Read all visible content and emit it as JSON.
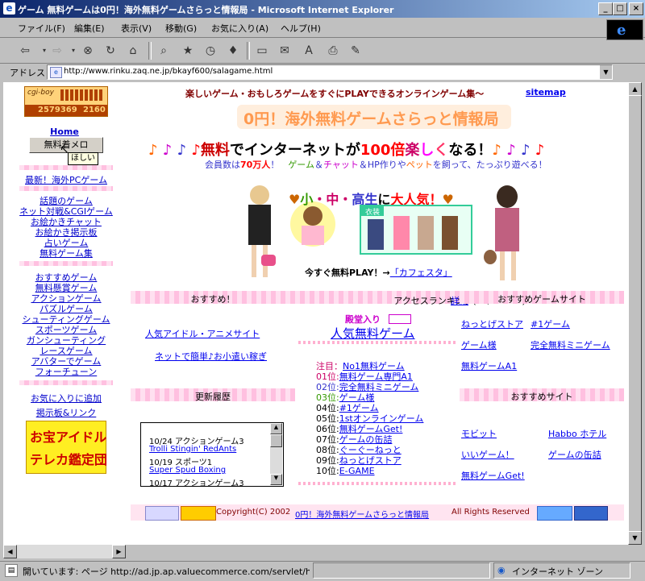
{
  "window": {
    "title": "ゲーム 無料ゲームは0円！海外無料ゲームさらっと情報局 - Microsoft Internet Explorer"
  },
  "menu": [
    "ファイル(F)",
    "編集(E)",
    "表示(V)",
    "移動(G)",
    "お気に入り(A)",
    "ヘルプ(H)"
  ],
  "address": {
    "label": "アドレス",
    "url": "http://www.rinku.zaq.ne.jp/bkayf600/salagame.html"
  },
  "counter": {
    "brand": "cgi-boy",
    "total": "2579369",
    "today": "2160"
  },
  "left_nav": {
    "home": "Home",
    "button": "無料着メロ",
    "tooltip": "ほしい",
    "group1": [
      "最新！海外PCゲーム"
    ],
    "group2": [
      "話題のゲーム",
      "ネット対戦&CGIゲーム",
      "お絵かきチャット",
      "お絵かき掲示板",
      "占いゲーム",
      "無料ゲーム集"
    ],
    "group3": [
      "おすすめゲーム",
      "無料懸賞ゲーム",
      "アクションゲーム",
      "パズルゲーム",
      "シューティングゲーム",
      "スポーツゲーム",
      "ガンシューティング",
      "レースゲーム",
      "アバターでゲーム",
      "フォーチューン"
    ],
    "group4": [
      "お気に入りに追加",
      "掲示板&リンク"
    ],
    "banner_line1": "お宝アイドル",
    "banner_line2": "テレカ鑑定団"
  },
  "top_tagline": "楽しいゲーム・おもしろゲームをすぐにPLAYできるオンラインゲーム集～",
  "sitemap": "sitemap",
  "site_title": "0円！海外無料ゲームさらっと情報局",
  "promo": {
    "notes": "♪ ♪ ♪ ♪",
    "notes_right": "♪ ♪ ♪ ♪",
    "w1": "無料",
    "w2": "でインターネットが",
    "w3": "100倍",
    "w4": "楽",
    "w5": "し",
    "w6": "く",
    "w7": "なる！",
    "sub1": "会員数は",
    "sub2": "70万人",
    "sub3": "！　",
    "sub4": "ゲーム",
    "sub5": "＆",
    "sub6": "チャット",
    "sub7": "＆HP作りや",
    "sub8": "ペット",
    "sub9": "を飼って、たっぷり遊べる！"
  },
  "school": {
    "heart": "♥",
    "sho": "小",
    "dot": "・",
    "chu": "中",
    "kou": "高生",
    "ni": "に",
    "big": "大人気！",
    "costume": "衣装"
  },
  "cafe": {
    "pre": "今すぐ無料PLAY！→",
    "link": "「カフェスタ」"
  },
  "bars": {
    "osusume": "おすすめ！",
    "ranking": "アクセスランキング(10/19～26)",
    "detail": "詳細",
    "recommended_sites": "おすすめゲームサイト",
    "history": "更新履歴",
    "recommended": "おすすめサイト"
  },
  "left_links": [
    "人気アイドル・アニメサイト",
    "ネットで簡単♪お小遣い稼ぎ"
  ],
  "hall": {
    "label": "殿堂入り",
    "link": "人気無料ゲーム"
  },
  "ranking": {
    "top_label": "注目：",
    "top_item": "No1無料ゲーム",
    "items": [
      {
        "pos": "01位:",
        "name": "無料ゲーム専門A1"
      },
      {
        "pos": "02位:",
        "name": "完全無料ミニゲーム"
      },
      {
        "pos": "03位:",
        "name": "ゲーム様"
      },
      {
        "pos": "04位:",
        "name": "#1ゲーム"
      },
      {
        "pos": "05位:",
        "name": "1stオンラインゲーム"
      },
      {
        "pos": "06位:",
        "name": "無料ゲームGet!"
      },
      {
        "pos": "07位:",
        "name": "ゲームの缶詰"
      },
      {
        "pos": "08位:",
        "name": "ぐーぐーねっと"
      },
      {
        "pos": "09位:",
        "name": "ねっとげストア"
      },
      {
        "pos": "10位:",
        "name": "E-GAME"
      }
    ]
  },
  "right_sites1": [
    "ねっとげストア",
    "#1ゲーム",
    "ゲーム様",
    "完全無料ミニゲーム",
    "無料ゲームA1"
  ],
  "right_sites2": [
    "モビット",
    "Habbo ホテル",
    "いいゲーム！",
    "ゲームの缶詰",
    "無料ゲームGet!"
  ],
  "history": [
    "10/24 アクションゲーム3",
    "Trolli Stingin' RedAnts",
    "10/19 スポーツ1",
    "Super Spud Boxing",
    "10/17 アクションゲーム3"
  ],
  "footer": {
    "copyright": "Copyright(C) 2002",
    "site": "0円！海外無料ゲームさらっと情報局",
    "rights": "All Rights Reserved"
  },
  "status": {
    "text": "開いています: ページ http://ad.jp.ap.valuecommerce.com/servlet/htmlbanner?sid=...",
    "zone": "インターネット ゾーン"
  },
  "colors": {
    "title_bar": "#0a246a",
    "link": "#0000cc",
    "pink": "#ffc0e0",
    "orange": "#ff6600"
  }
}
